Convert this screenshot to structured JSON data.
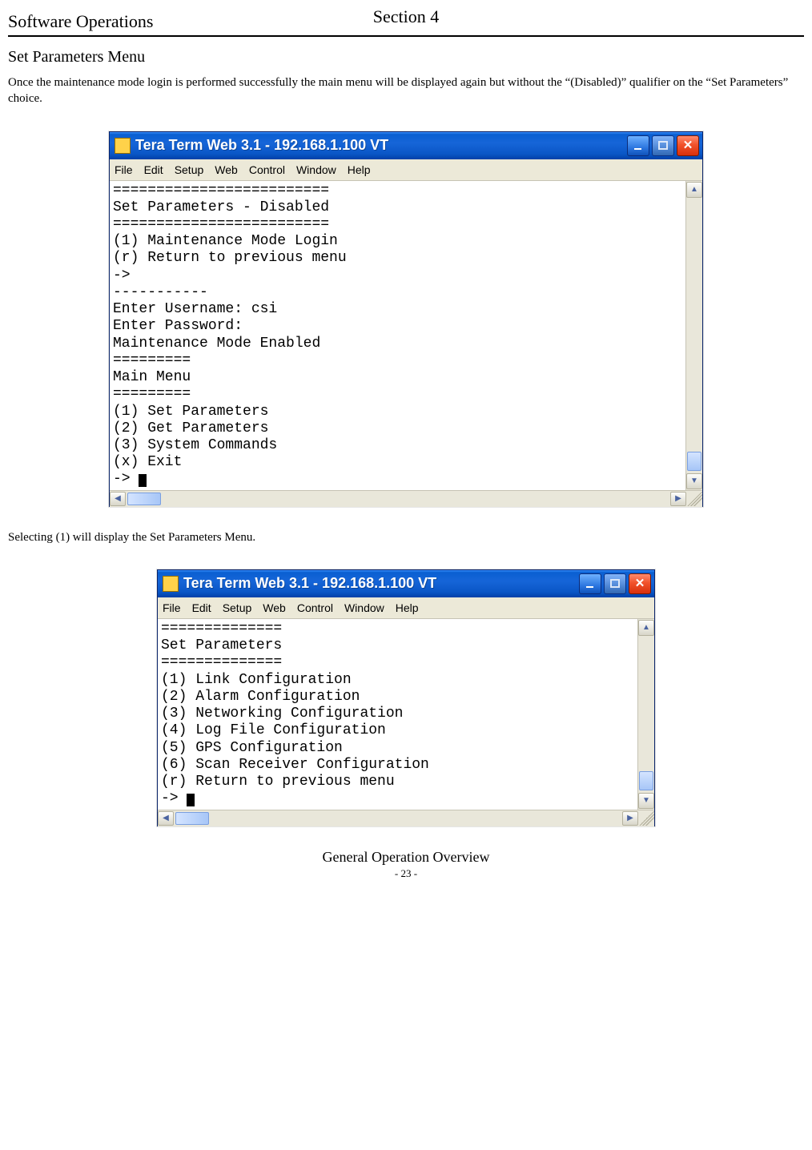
{
  "doc": {
    "header_left": "Software Operations",
    "header_center": "Section 4",
    "section_title": "Set  Parameters  Menu",
    "paragraph1": "Once  the  maintenance mode  login is performed successfully the  main menu  will be  displayed again but  without the “(Disabled)” qualifier on the “Set Parameters” choice.",
    "paragraph2": "Selecting (1) will display  the  Set  Parameters  Menu.",
    "footer": "General Operation Overview",
    "page_number": "- 23 -"
  },
  "window1": {
    "title": "Tera Term Web 3.1 - 192.168.1.100 VT",
    "menu": [
      "File",
      "Edit",
      "Setup",
      "Web",
      "Control",
      "Window",
      "Help"
    ],
    "terminal_lines": [
      "=========================",
      "Set Parameters - Disabled",
      "=========================",
      "(1) Maintenance Mode Login",
      "(r) Return to previous menu",
      "->",
      "-----------",
      "Enter Username: csi",
      "Enter Password:",
      "Maintenance Mode Enabled",
      "=========",
      "Main Menu",
      "=========",
      "(1) Set Parameters",
      "(2) Get Parameters",
      "(3) System Commands",
      "(x) Exit",
      "-> "
    ]
  },
  "window2": {
    "title": "Tera Term Web 3.1 - 192.168.1.100 VT",
    "menu": [
      "File",
      "Edit",
      "Setup",
      "Web",
      "Control",
      "Window",
      "Help"
    ],
    "terminal_lines": [
      "==============",
      "Set Parameters",
      "==============",
      "(1) Link Configuration",
      "(2) Alarm Configuration",
      "(3) Networking Configuration",
      "(4) Log File Configuration",
      "(5) GPS Configuration",
      "(6) Scan Receiver Configuration",
      "(r) Return to previous menu",
      "-> "
    ]
  }
}
